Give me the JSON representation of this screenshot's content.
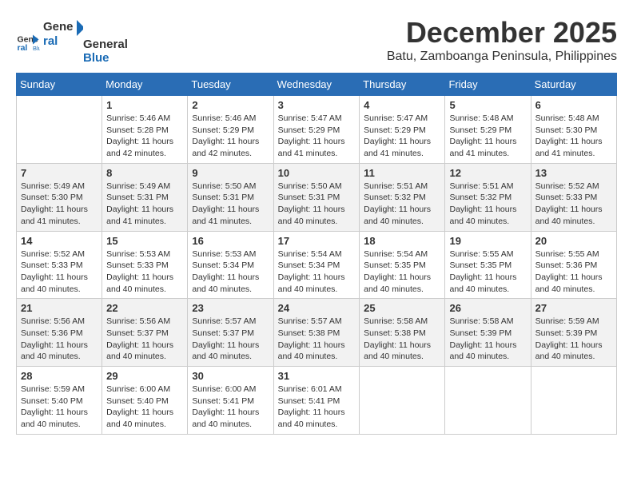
{
  "logo": {
    "line1": "General",
    "line2": "Blue"
  },
  "title": "December 2025",
  "subtitle": "Batu, Zamboanga Peninsula, Philippines",
  "days_header": [
    "Sunday",
    "Monday",
    "Tuesday",
    "Wednesday",
    "Thursday",
    "Friday",
    "Saturday"
  ],
  "weeks": [
    [
      {
        "day": "",
        "info": ""
      },
      {
        "day": "1",
        "info": "Sunrise: 5:46 AM\nSunset: 5:28 PM\nDaylight: 11 hours\nand 42 minutes."
      },
      {
        "day": "2",
        "info": "Sunrise: 5:46 AM\nSunset: 5:29 PM\nDaylight: 11 hours\nand 42 minutes."
      },
      {
        "day": "3",
        "info": "Sunrise: 5:47 AM\nSunset: 5:29 PM\nDaylight: 11 hours\nand 41 minutes."
      },
      {
        "day": "4",
        "info": "Sunrise: 5:47 AM\nSunset: 5:29 PM\nDaylight: 11 hours\nand 41 minutes."
      },
      {
        "day": "5",
        "info": "Sunrise: 5:48 AM\nSunset: 5:29 PM\nDaylight: 11 hours\nand 41 minutes."
      },
      {
        "day": "6",
        "info": "Sunrise: 5:48 AM\nSunset: 5:30 PM\nDaylight: 11 hours\nand 41 minutes."
      }
    ],
    [
      {
        "day": "7",
        "info": "Sunrise: 5:49 AM\nSunset: 5:30 PM\nDaylight: 11 hours\nand 41 minutes."
      },
      {
        "day": "8",
        "info": "Sunrise: 5:49 AM\nSunset: 5:31 PM\nDaylight: 11 hours\nand 41 minutes."
      },
      {
        "day": "9",
        "info": "Sunrise: 5:50 AM\nSunset: 5:31 PM\nDaylight: 11 hours\nand 41 minutes."
      },
      {
        "day": "10",
        "info": "Sunrise: 5:50 AM\nSunset: 5:31 PM\nDaylight: 11 hours\nand 40 minutes."
      },
      {
        "day": "11",
        "info": "Sunrise: 5:51 AM\nSunset: 5:32 PM\nDaylight: 11 hours\nand 40 minutes."
      },
      {
        "day": "12",
        "info": "Sunrise: 5:51 AM\nSunset: 5:32 PM\nDaylight: 11 hours\nand 40 minutes."
      },
      {
        "day": "13",
        "info": "Sunrise: 5:52 AM\nSunset: 5:33 PM\nDaylight: 11 hours\nand 40 minutes."
      }
    ],
    [
      {
        "day": "14",
        "info": "Sunrise: 5:52 AM\nSunset: 5:33 PM\nDaylight: 11 hours\nand 40 minutes."
      },
      {
        "day": "15",
        "info": "Sunrise: 5:53 AM\nSunset: 5:33 PM\nDaylight: 11 hours\nand 40 minutes."
      },
      {
        "day": "16",
        "info": "Sunrise: 5:53 AM\nSunset: 5:34 PM\nDaylight: 11 hours\nand 40 minutes."
      },
      {
        "day": "17",
        "info": "Sunrise: 5:54 AM\nSunset: 5:34 PM\nDaylight: 11 hours\nand 40 minutes."
      },
      {
        "day": "18",
        "info": "Sunrise: 5:54 AM\nSunset: 5:35 PM\nDaylight: 11 hours\nand 40 minutes."
      },
      {
        "day": "19",
        "info": "Sunrise: 5:55 AM\nSunset: 5:35 PM\nDaylight: 11 hours\nand 40 minutes."
      },
      {
        "day": "20",
        "info": "Sunrise: 5:55 AM\nSunset: 5:36 PM\nDaylight: 11 hours\nand 40 minutes."
      }
    ],
    [
      {
        "day": "21",
        "info": "Sunrise: 5:56 AM\nSunset: 5:36 PM\nDaylight: 11 hours\nand 40 minutes."
      },
      {
        "day": "22",
        "info": "Sunrise: 5:56 AM\nSunset: 5:37 PM\nDaylight: 11 hours\nand 40 minutes."
      },
      {
        "day": "23",
        "info": "Sunrise: 5:57 AM\nSunset: 5:37 PM\nDaylight: 11 hours\nand 40 minutes."
      },
      {
        "day": "24",
        "info": "Sunrise: 5:57 AM\nSunset: 5:38 PM\nDaylight: 11 hours\nand 40 minutes."
      },
      {
        "day": "25",
        "info": "Sunrise: 5:58 AM\nSunset: 5:38 PM\nDaylight: 11 hours\nand 40 minutes."
      },
      {
        "day": "26",
        "info": "Sunrise: 5:58 AM\nSunset: 5:39 PM\nDaylight: 11 hours\nand 40 minutes."
      },
      {
        "day": "27",
        "info": "Sunrise: 5:59 AM\nSunset: 5:39 PM\nDaylight: 11 hours\nand 40 minutes."
      }
    ],
    [
      {
        "day": "28",
        "info": "Sunrise: 5:59 AM\nSunset: 5:40 PM\nDaylight: 11 hours\nand 40 minutes."
      },
      {
        "day": "29",
        "info": "Sunrise: 6:00 AM\nSunset: 5:40 PM\nDaylight: 11 hours\nand 40 minutes."
      },
      {
        "day": "30",
        "info": "Sunrise: 6:00 AM\nSunset: 5:41 PM\nDaylight: 11 hours\nand 40 minutes."
      },
      {
        "day": "31",
        "info": "Sunrise: 6:01 AM\nSunset: 5:41 PM\nDaylight: 11 hours\nand 40 minutes."
      },
      {
        "day": "",
        "info": ""
      },
      {
        "day": "",
        "info": ""
      },
      {
        "day": "",
        "info": ""
      }
    ]
  ]
}
